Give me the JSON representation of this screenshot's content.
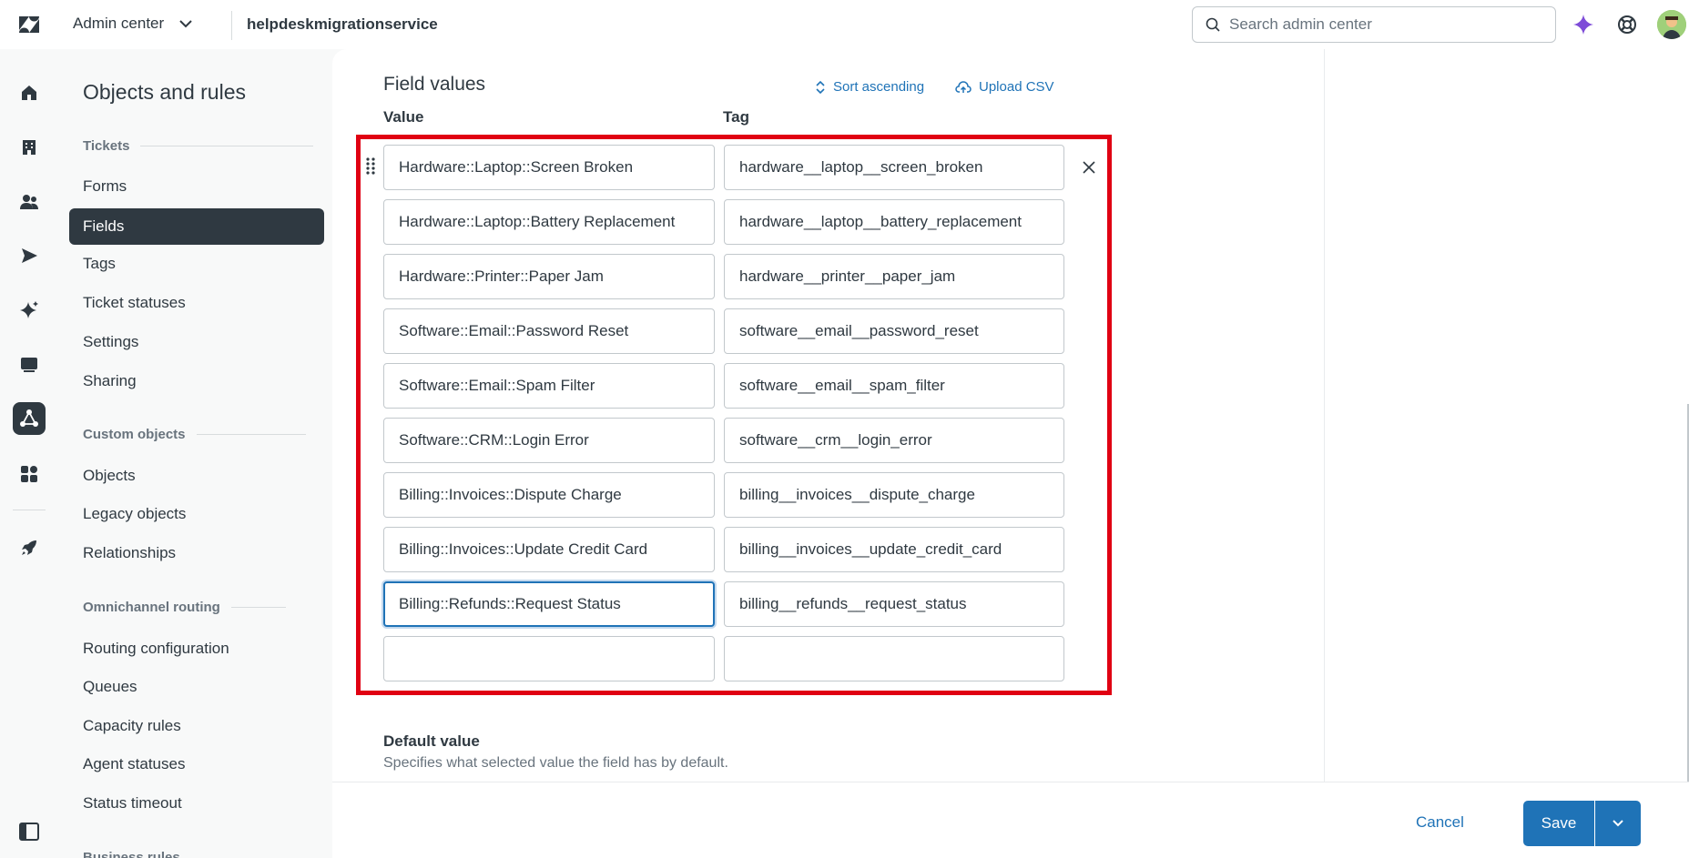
{
  "topbar": {
    "product_label": "Admin center",
    "account_name": "helpdeskmigrationservice",
    "search_placeholder": "Search admin center"
  },
  "nav": {
    "title": "Objects and rules",
    "sections": [
      {
        "label": "Tickets",
        "items": [
          "Forms",
          "Fields",
          "Tags",
          "Ticket statuses",
          "Settings",
          "Sharing"
        ]
      },
      {
        "label": "Custom objects",
        "items": [
          "Objects",
          "Legacy objects",
          "Relationships"
        ]
      },
      {
        "label": "Omnichannel routing",
        "items": [
          "Routing configuration",
          "Queues",
          "Capacity rules",
          "Agent statuses",
          "Status timeout"
        ]
      },
      {
        "label": "Business rules",
        "items": []
      }
    ],
    "active_item": "Fields"
  },
  "field_values": {
    "title": "Field values",
    "sort_label": "Sort ascending",
    "upload_label": "Upload CSV",
    "value_header": "Value",
    "tag_header": "Tag",
    "rows": [
      {
        "value": "Hardware::Laptop::Screen Broken",
        "tag": "hardware__laptop__screen_broken"
      },
      {
        "value": "Hardware::Laptop::Battery Replacement",
        "tag": "hardware__laptop__battery_replacement"
      },
      {
        "value": "Hardware::Printer::Paper Jam",
        "tag": "hardware__printer__paper_jam"
      },
      {
        "value": "Software::Email::Password Reset",
        "tag": "software__email__password_reset"
      },
      {
        "value": "Software::Email::Spam Filter",
        "tag": "software__email__spam_filter"
      },
      {
        "value": "Software::CRM::Login Error",
        "tag": "software__crm__login_error"
      },
      {
        "value": "Billing::Invoices::Dispute Charge",
        "tag": "billing__invoices__dispute_charge"
      },
      {
        "value": "Billing::Invoices::Update Credit Card",
        "tag": "billing__invoices__update_credit_card"
      },
      {
        "value": "Billing::Refunds::Request Status",
        "tag": "billing__refunds__request_status"
      },
      {
        "value": "",
        "tag": ""
      }
    ]
  },
  "default_value": {
    "title": "Default value",
    "description": "Specifies what selected value the field has by default."
  },
  "footer": {
    "cancel_label": "Cancel",
    "save_label": "Save"
  },
  "colors": {
    "accent": "#1f73b7",
    "highlight": "#e00012",
    "dark": "#2f3941"
  },
  "icons": [
    "zendesk-logo-icon",
    "chevron-down-icon",
    "search-icon",
    "ai-sparkle-icon",
    "help-lifebuoy-icon",
    "avatar",
    "home-icon",
    "building-icon",
    "people-icon",
    "send-icon",
    "sparkle-icon",
    "chat-icon",
    "objects-rules-icon",
    "apps-icon",
    "rocket-icon",
    "sidebar-toggle-icon",
    "sort-icon",
    "upload-cloud-icon",
    "drag-handle-icon",
    "close-icon"
  ]
}
